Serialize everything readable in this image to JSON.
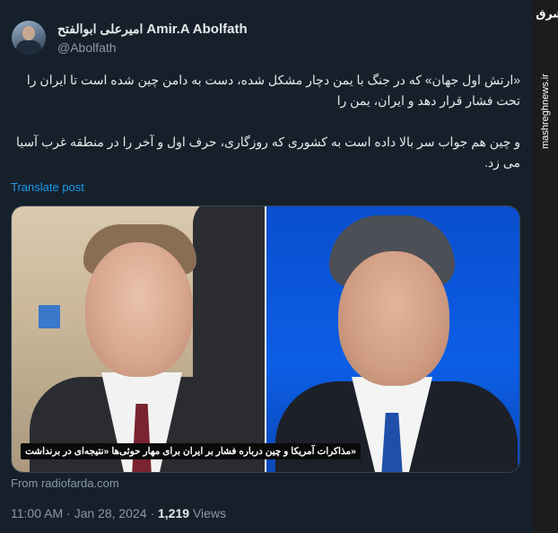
{
  "author": {
    "display_name": "Amir.A Abolfath",
    "display_name_fa": "امیرعلی ابوالفتح",
    "handle": "@Abolfath"
  },
  "tweet": {
    "paragraph_1": "«ارتش اول جهان» که در جنگ با یمن دچار مشکل شده، دست به دامن چین شده است تا ایران را تحت فشار قرار دهد و ایران، یمن را",
    "paragraph_2": "و چین هم جواب سر بالا داده است به کشوری که روزگاری، حرف اول و آخر را در منطقه غرب آسیا می زد.",
    "translate_label": "Translate post"
  },
  "media": {
    "caption": "«مذاکرات آمریکا و چین درباره فشار بر ایران برای مهار حوثی‌ها «نتیجه‌ای در برنداشت",
    "source": "From radiofarda.com"
  },
  "meta": {
    "time": "11:00 AM",
    "date": "Jan 28, 2024",
    "views_count": "1,219",
    "views_label": "Views"
  },
  "sidebar": {
    "logo_text": "مشرق",
    "site": "mashreghnews.ir"
  },
  "colors": {
    "background": "#15202b",
    "link": "#1d9bf0",
    "secondary_text": "#8b98a5"
  }
}
